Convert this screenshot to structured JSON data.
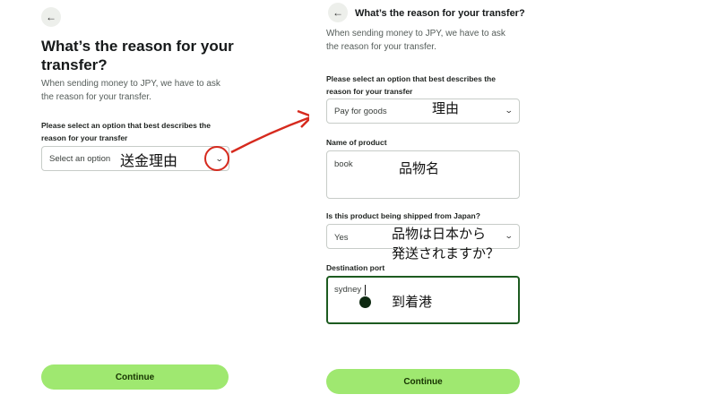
{
  "left": {
    "back_icon": "←",
    "title_line1": "What’s the reason for your",
    "title_line2": "transfer?",
    "subtitle_line1": "When sending money to JPY, we have to ask",
    "subtitle_line2": "the reason for your transfer.",
    "select_label_line1": "Please select an option that best describes the",
    "select_label_line2": "reason for your transfer",
    "select_placeholder": "Select an option",
    "continue_label": "Continue",
    "note_reason": "送金理由"
  },
  "right": {
    "back_icon": "←",
    "title": "What’s the reason for your transfer?",
    "subtitle_line1": "When sending money to JPY, we have to ask",
    "subtitle_line2": "the reason for your transfer.",
    "select_label_line1": "Please select an option that best describes the",
    "select_label_line2": "reason for your transfer",
    "select_value": "Pay for goods",
    "product_label": "Name of product",
    "product_value": "book",
    "shipped_label": "Is this product being shipped from Japan?",
    "shipped_value": "Yes",
    "port_label": "Destination port",
    "port_value": "sydney",
    "continue_label": "Continue",
    "note_reason": "理由",
    "note_product": "品物名",
    "note_shipped_line1": "品物は日本から",
    "note_shipped_line2": "発送されますか？",
    "note_port": "到着港"
  },
  "colors": {
    "accent": "#9fe870",
    "annotation": "#d62a1e",
    "active_border": "#1d5b20"
  }
}
